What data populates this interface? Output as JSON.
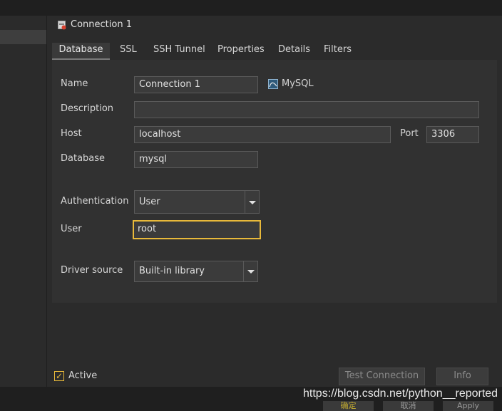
{
  "window": {
    "title": "Connection 1"
  },
  "tabs": [
    "Database",
    "SSL",
    "SSH Tunnel",
    "Properties",
    "Details",
    "Filters"
  ],
  "form": {
    "name_label": "Name",
    "name_value": "Connection 1",
    "driver_label": "MySQL",
    "description_label": "Description",
    "description_value": "",
    "host_label": "Host",
    "host_value": "localhost",
    "port_label": "Port",
    "port_value": "3306",
    "database_label": "Database",
    "database_value": "mysql",
    "auth_label": "Authentication",
    "auth_value": "User",
    "user_label": "User",
    "user_value": "root",
    "driver_source_label": "Driver source",
    "driver_source_value": "Built-in library"
  },
  "footer": {
    "active_label": "Active",
    "active_checked": true,
    "test_connection_label": "Test Connection",
    "info_label": "Info",
    "ok_label": "确定",
    "cancel_label": "取消",
    "apply_label": "Apply"
  },
  "watermark": "https://blog.csdn.net/python__reported",
  "colors": {
    "accent": "#e8b93a",
    "panel": "#2b2b2b",
    "field": "#3b3b3b"
  }
}
